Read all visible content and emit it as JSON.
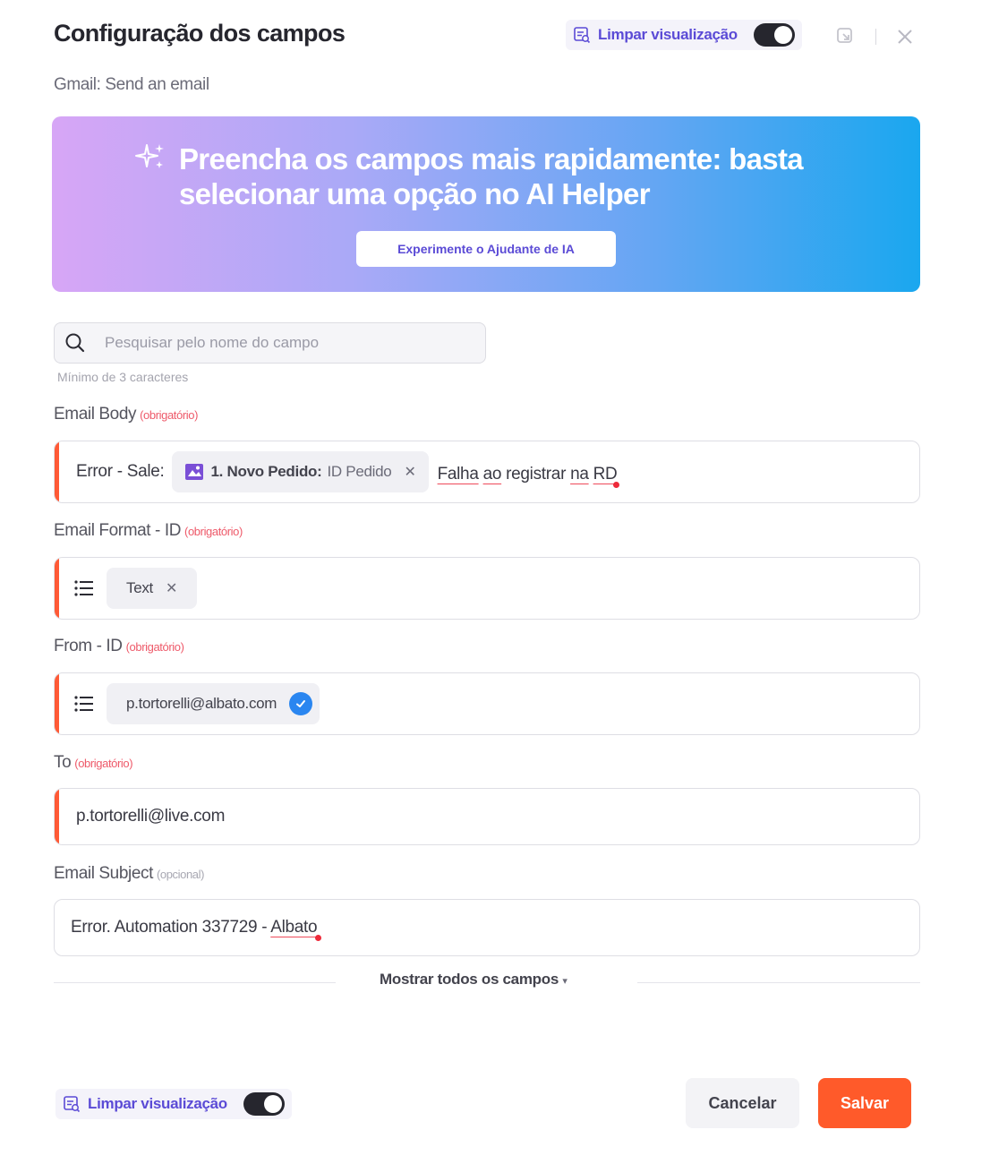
{
  "header": {
    "title": "Configuração dos campos",
    "subtitle": "Gmail: Send an email",
    "preview_label": "Limpar visualização"
  },
  "banner": {
    "text": "Preencha os campos mais rapidamente: basta selecionar uma opção no AI Helper",
    "button_label": "Experimente o Ajudante de IA"
  },
  "search": {
    "placeholder": "Pesquisar pelo nome do campo",
    "hint": "Mínimo de 3 caracteres"
  },
  "fields": {
    "email_body": {
      "label": "Email Body",
      "tag": "(obrigatório)",
      "prefix": "Error -  Sale:",
      "chip_bold": "1. Novo Pedido:",
      "chip_rest": "ID Pedido",
      "words": [
        "Falha",
        "ao",
        "registrar",
        "na",
        "RD"
      ]
    },
    "email_format": {
      "label": "Email Format - ID",
      "tag": "(obrigatório)",
      "chip": "Text"
    },
    "from": {
      "label": "From - ID",
      "tag": "(obrigatório)",
      "chip": "p.tortorelli@albato.com"
    },
    "to": {
      "label": "To",
      "tag": "(obrigatório)",
      "value": "p.tortorelli@live.com"
    },
    "email_subject": {
      "label": "Email Subject",
      "tag": "(opcional)",
      "value_prefix": "Error.  Automation 337729 -",
      "value_word": "Albato"
    }
  },
  "show_all_label": "Mostrar todos os campos",
  "footer": {
    "preview_label": "Limpar visualização",
    "cancel_label": "Cancelar",
    "save_label": "Salvar"
  },
  "colors": {
    "accent": "#ff5a2a",
    "required": "#ee5a6a",
    "link": "#5b4bd6",
    "verified": "#2a86f0"
  }
}
